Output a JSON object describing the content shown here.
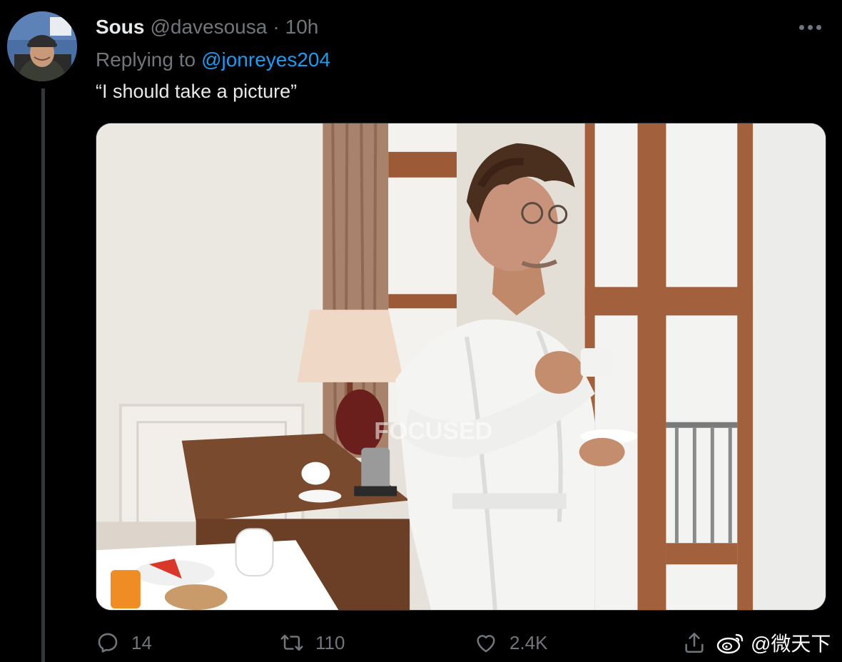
{
  "tweet": {
    "display_name": "Sous",
    "handle": "@davesousa",
    "separator": "·",
    "time": "10h",
    "replying_prefix": "Replying to",
    "replying_to": "@jonreyes204",
    "text": "“I should take a picture”",
    "media": {
      "watermark_text": "FOCUSED"
    }
  },
  "actions": {
    "reply_count": "14",
    "retweet_count": "110",
    "like_count": "2.4K"
  },
  "overlay_watermark": {
    "text": "@微天下"
  },
  "icons": {
    "more": "more-icon",
    "reply": "reply-icon",
    "retweet": "retweet-icon",
    "like": "heart-icon",
    "share": "share-icon",
    "weibo": "weibo-logo-icon"
  },
  "colors": {
    "background": "#000000",
    "primary_text": "#e7e9ea",
    "secondary_text": "#71767b",
    "link": "#1d9bf0",
    "thread_line": "#333639"
  }
}
